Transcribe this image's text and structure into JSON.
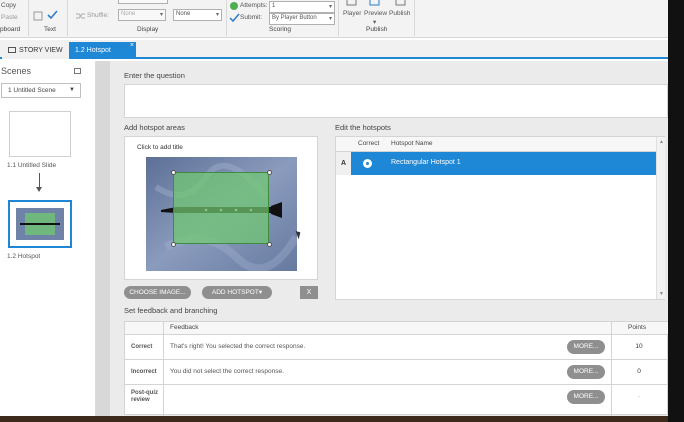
{
  "ribbon": {
    "clipboard": {
      "copy_label": "Copy",
      "paste_label": "Paste",
      "group_label": "Clipboard",
      "group_visible": "pboard"
    },
    "text_group": {
      "label": "Text"
    },
    "display": {
      "shuffle_label": "Shuffle:",
      "combo1_value": "None",
      "combo2_value": "None",
      "group_label": "Display"
    },
    "scoring": {
      "attempts_label": "Attempts:",
      "attempts_value": "1",
      "submit_label": "Submit:",
      "submit_value": "By Player Button",
      "group_label": "Scoring"
    },
    "publish": {
      "player_label": "Player",
      "preview_label": "Preview",
      "publish_label": "Publish",
      "group_label": "Publish"
    }
  },
  "tabs": [
    {
      "label": "STORY VIEW",
      "active": false
    },
    {
      "label": "1.2 Hotspot",
      "active": true
    }
  ],
  "scenes": {
    "title": "Scenes",
    "dropdown_value": "1 Untitled Scene",
    "slides": [
      {
        "label": "1.1 Untitled Slide"
      },
      {
        "label": "1.2 Hotspot"
      }
    ]
  },
  "editor": {
    "question_label": "Enter the question",
    "question_value": "",
    "hotspot_areas_label": "Add hotspot areas",
    "click_title": "Click to add title",
    "choose_image_label": "CHOOSE IMAGE...",
    "add_hotspot_label": "ADD HOTSPOT▾",
    "remove_label": "X",
    "edit_hotspots_label": "Edit the hotspots",
    "hotspot_columns": [
      "Correct",
      "Hotspot Name"
    ],
    "hotspots": [
      {
        "letter": "A",
        "correct": true,
        "name": "Rectangular Hotspot 1"
      }
    ],
    "feedback_label": "Set feedback and branching",
    "feedback_columns": [
      "Feedback",
      "Points"
    ],
    "feedback_rows": [
      {
        "label": "Correct",
        "text": "That's right!  You selected the correct response.",
        "more": "MORE...",
        "points": "10"
      },
      {
        "label": "Incorrect",
        "text": "You did not select the correct response.",
        "more": "MORE...",
        "points": "0"
      },
      {
        "label": "Post-quiz review",
        "text": "",
        "more": "MORE...",
        "points": "-"
      }
    ]
  },
  "colors": {
    "accent": "#1e87d6",
    "hotspot_fill": "#70c870",
    "button_gray": "#8f8f8f"
  }
}
